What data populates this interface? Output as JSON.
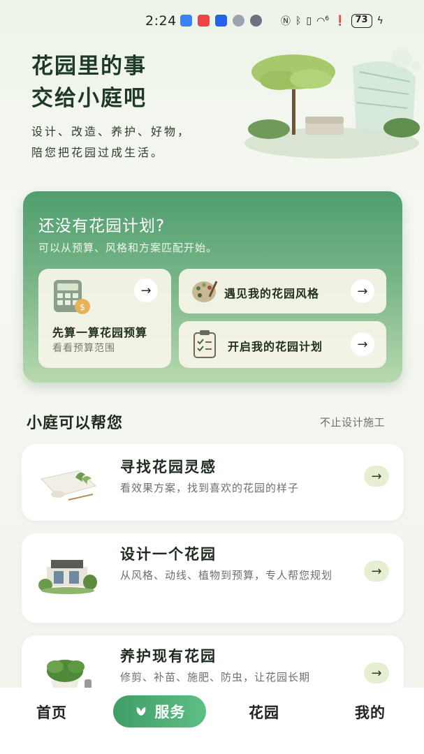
{
  "status_bar": {
    "time": "2:24",
    "battery": "73",
    "network_label": "6"
  },
  "hero": {
    "title_line1": "花园里的事",
    "title_line2": "交给小庭吧",
    "subtitle_line1": "设计、改造、养护、好物，",
    "subtitle_line2": "陪您把花园过成生活。"
  },
  "plan_card": {
    "title": "还没有花园计划?",
    "subtitle": "可以从预算、风格和方案匹配开始。",
    "budget": {
      "label": "先算一算花园预算",
      "hint": "看看预算范围"
    },
    "style": {
      "label": "遇见我的花园风格"
    },
    "plan": {
      "label": "开启我的花园计划"
    },
    "arrow": "→"
  },
  "help": {
    "title": "小庭可以帮您",
    "more": "不止设计施工",
    "services": [
      {
        "title": "寻找花园灵感",
        "desc": "看效果方案，找到喜欢的花园的样子",
        "icon": "inspiration-icon"
      },
      {
        "title": "设计一个花园",
        "desc": "从风格、动线、植物到预算，专人帮您规划",
        "icon": "design-icon"
      },
      {
        "title": "养护现有花园",
        "desc": "修剪、补苗、施肥、防虫，让花园长期",
        "icon": "maintenance-icon"
      }
    ]
  },
  "nav": {
    "home": "首页",
    "service": "服务",
    "garden": "花园",
    "mine": "我的"
  },
  "colors": {
    "accent": "#4fae74",
    "card_green": "#6aae7e",
    "arrow_bg": "#e7efd3"
  }
}
